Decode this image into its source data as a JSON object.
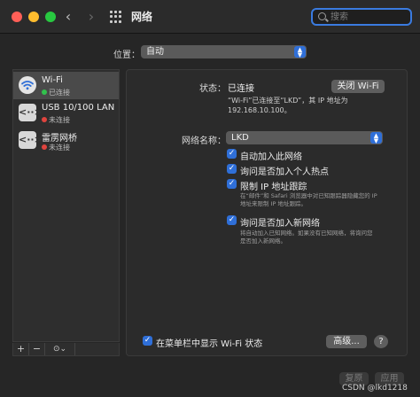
{
  "window": {
    "title": "网络",
    "back_glyph": "‹",
    "forward_glyph": "›",
    "search_placeholder": "搜索"
  },
  "location": {
    "label": "位置：",
    "value": "自动"
  },
  "sidebar": {
    "items": [
      {
        "name": "Wi-Fi",
        "status": "已连接",
        "status_color": "#32c24d",
        "icon": "wifi-icon",
        "selected": true
      },
      {
        "name": "USB 10/100 LAN",
        "status": "未连接",
        "status_color": "#e0443e",
        "icon": "ethernet-icon",
        "selected": false
      },
      {
        "name": "雷雳网桥",
        "status": "未连接",
        "status_color": "#e0443e",
        "icon": "bridge-icon",
        "selected": false
      }
    ],
    "add_label": "+",
    "remove_label": "−",
    "more_label": "⊙⌄"
  },
  "detail": {
    "status_label": "状态：",
    "status_value": "已连接",
    "turn_off_button": "关闭 Wi-Fi",
    "status_desc_line1": "“Wi-Fi”已连接至“LKD”，其 IP 地址为",
    "status_desc_line2": "192.168.10.100。",
    "network_name_label": "网络名称：",
    "network_name_value": "LKD",
    "options": [
      {
        "label": "自动加入此网络",
        "checked": true
      },
      {
        "label": "询问是否加入个人热点",
        "checked": true
      },
      {
        "label": "限制 IP 地址跟踪",
        "checked": true
      },
      {
        "label": "询问是否加入新网络",
        "checked": true
      }
    ],
    "ip_tracking_desc_line1": "在“邮件”和 Safari 浏览器中对已知跟踪器隐藏您的 IP",
    "ip_tracking_desc_line2": "地址来限制 IP 地址跟踪。",
    "new_network_desc_line1": "将自动加入已知网络。如果没有已知网络，将询问您",
    "new_network_desc_line2": "是否加入新网络。",
    "show_in_menubar_label": "在菜单栏中显示 Wi-Fi 状态",
    "advanced_button": "高级...",
    "help_button": "?"
  },
  "footer": {
    "revert_button": "复原",
    "apply_button": "应用"
  },
  "watermark": "CSDN @lkd1218",
  "colors": {
    "accent": "#2f6fd8",
    "connected": "#32c24d",
    "disconnected": "#e0443e"
  }
}
